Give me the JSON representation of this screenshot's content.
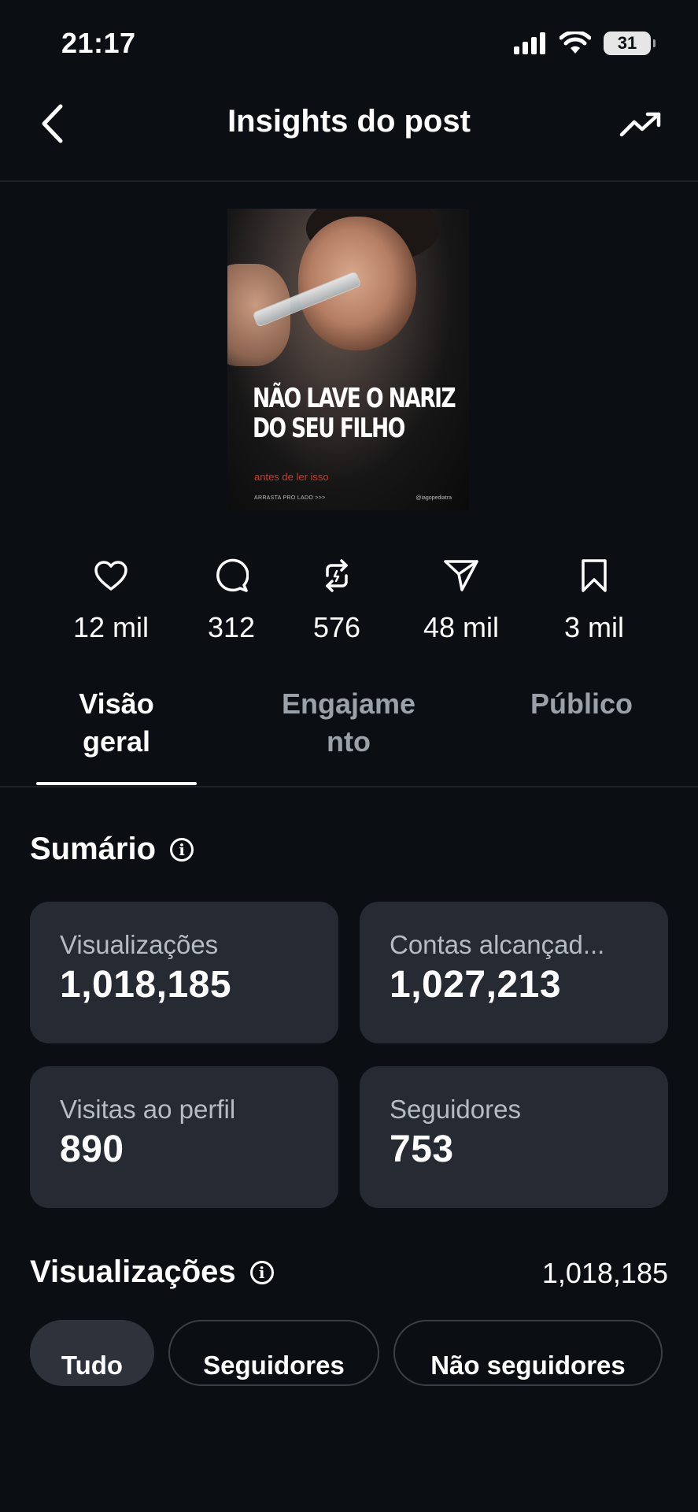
{
  "status_bar": {
    "time": "21:17",
    "battery": "31"
  },
  "nav": {
    "title": "Insights do post"
  },
  "post": {
    "headline_line1": "NÃO LAVE O NARIZ",
    "headline_line2": "DO SEU FILHO",
    "subtitle": "antes de ler isso",
    "footer_left": "ARRASTA PRO LADO >>>",
    "footer_right": "@iagopediatra"
  },
  "stats": [
    {
      "icon": "heart-icon",
      "value": "12 mil"
    },
    {
      "icon": "comment-icon",
      "value": "312"
    },
    {
      "icon": "repost-icon",
      "value": "576"
    },
    {
      "icon": "share-icon",
      "value": "48 mil"
    },
    {
      "icon": "bookmark-icon",
      "value": "3 mil"
    }
  ],
  "tabs": [
    {
      "line1": "Visão",
      "line2": "geral",
      "active": true
    },
    {
      "line1": "Engajame",
      "line2": "nto",
      "active": false
    },
    {
      "line1": "Público",
      "line2": "",
      "active": false
    }
  ],
  "summary": {
    "title": "Sumário",
    "cards": [
      {
        "label": "Visualizações",
        "value": "1,018,185"
      },
      {
        "label": "Contas alcançad...",
        "value": "1,027,213"
      },
      {
        "label": "Visitas ao perfil",
        "value": "890"
      },
      {
        "label": "Seguidores",
        "value": "753"
      }
    ]
  },
  "views": {
    "title": "Visualizações",
    "total": "1,018,185",
    "filters": [
      {
        "label": "Tudo",
        "active": true
      },
      {
        "label": "Seguidores",
        "active": false
      },
      {
        "label": "Não seguidores",
        "active": false
      }
    ]
  }
}
